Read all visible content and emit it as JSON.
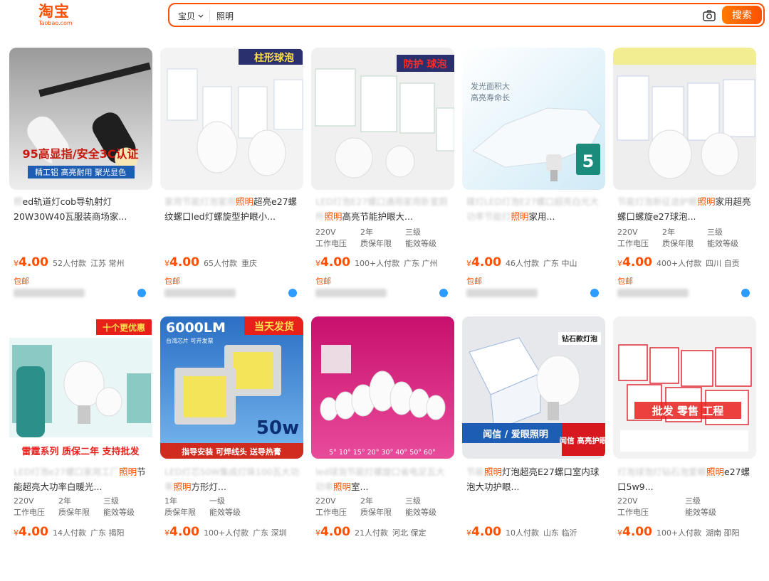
{
  "header": {
    "logo": "淘宝",
    "logo_sub": "Taobao.com",
    "scope": "宝贝",
    "query": "照明",
    "search_btn": "搜索"
  },
  "products": [
    {
      "title_pre": "照",
      "title_hl": "",
      "title_post": "ed轨道灯cob导轨射灯20W30W40瓦服装商场家...",
      "img_text_1": "95高显指/安全3C认证",
      "img_text_2": "精工铝 高亮耐用 聚光显色",
      "attrs": [],
      "price": "4.00",
      "sales": "52人付款",
      "loc": "江苏 常州",
      "ship": "包邮"
    },
    {
      "title_pre": "家用节能灯泡家用",
      "title_hl": "照明",
      "title_post": "超亮e27螺纹螺口led灯螺旋型护眼小...",
      "img_text_1": "柱形球泡",
      "img_text_2": "",
      "attrs": [],
      "price": "4.00",
      "sales": "65人付款",
      "loc": "重庆",
      "ship": "包邮"
    },
    {
      "title_pre": "LED灯泡E27螺口通用家用卧室厕所",
      "title_hl": "照明",
      "title_post": "高亮节能护眼大...",
      "img_text_1": "防护 球泡",
      "img_text_2": "",
      "attrs": [
        [
          "220V",
          "工作电压"
        ],
        [
          "2年",
          "质保年限"
        ],
        [
          "三级",
          "能效等级"
        ]
      ],
      "price": "4.00",
      "sales": "100+人付款",
      "loc": "广东 广州",
      "ship": "包邮"
    },
    {
      "title_pre": "碟灯LED灯泡E27螺口超亮白光大功率节能灯",
      "title_hl": "照明",
      "title_post": "家用...",
      "img_text_1": "发光面积大",
      "img_text_2": "高亮寿命长",
      "attrs": [],
      "price": "4.00",
      "sales": "46人付款",
      "loc": "广东 中山",
      "ship": "包邮"
    },
    {
      "title_pre": "节能灯泡新征途护眼",
      "title_hl": "照明",
      "title_post": "家用超亮螺口螺旋e27球泡...",
      "img_text_1": "",
      "img_text_2": "",
      "attrs": [
        [
          "220V",
          "工作电压"
        ],
        [
          "2年",
          "质保年限"
        ],
        [
          "三级",
          "能效等级"
        ]
      ],
      "price": "4.00",
      "sales": "400+人付款",
      "loc": "四川 自贡",
      "ship": "包邮"
    },
    {
      "title_pre": "LED灯泡e27螺口家用工厂",
      "title_hl": "照明",
      "title_post": "节能超亮大功率白暖光...",
      "img_text_1": "十个更优惠",
      "img_text_2": "雷霆系列 质保二年 支持批发",
      "attrs": [
        [
          "220V",
          "工作电压"
        ],
        [
          "2年",
          "质保年限"
        ],
        [
          "三级",
          "能效等级"
        ]
      ],
      "price": "4.00",
      "sales": "14人付款",
      "loc": "广东 揭阳",
      "ship": ""
    },
    {
      "title_pre": "LED灯芯50W集成灯珠100瓦大功率",
      "title_hl": "照明",
      "title_post": "方形灯...",
      "img_text_1": "6000LM",
      "img_text_2": "当天发货",
      "img_text_3": "指导安装 可焊线头 送导热膏",
      "img_text_4": "50w",
      "img_text_5": "台湾芯片 可开发票",
      "attrs": [
        [
          "1年",
          "质保年限"
        ],
        [
          "一级",
          "能效等级"
        ]
      ],
      "price": "4.00",
      "sales": "100+人付款",
      "loc": "广东 深圳",
      "ship": ""
    },
    {
      "title_pre": "led球泡节能灯螺旋口省电足瓦大功率",
      "title_hl": "照明",
      "title_post": "室...",
      "img_text_1": "5° 10° 15° 20° 30° 40° 50° 60°",
      "img_text_2": "",
      "attrs": [
        [
          "220V",
          "工作电压"
        ],
        [
          "2年",
          "质保年限"
        ],
        [
          "三级",
          "能效等级"
        ]
      ],
      "price": "4.00",
      "sales": "21人付款",
      "loc": "河北 保定",
      "ship": ""
    },
    {
      "title_pre": "节能",
      "title_hl": "照明",
      "title_post": "灯泡超亮E27螺口室内球泡大功护眼...",
      "img_text_1": "钻石款灯泡",
      "img_text_2": "闻信 / 爱眼照明",
      "img_text_3": "闻信 高亮护眼",
      "attrs": [],
      "price": "4.00",
      "sales": "10人付款",
      "loc": "山东 临沂",
      "ship": ""
    },
    {
      "title_pre": "灯泡球泡灯钻石泡爱眼",
      "title_hl": "照明",
      "title_post": "e27螺口5w9...",
      "img_text_1": "批发 零售 工程",
      "img_text_2": "",
      "attrs": [
        [
          "220V",
          "工作电压"
        ],
        [
          "三级",
          "能效等级"
        ]
      ],
      "price": "4.00",
      "sales": "100+人付款",
      "loc": "湖南 邵阳",
      "ship": ""
    }
  ],
  "currency": "¥",
  "colors": {
    "accent": "#ff5000",
    "pink": "#d9147a",
    "blue": "#1d5db3",
    "red": "#e8201c"
  }
}
